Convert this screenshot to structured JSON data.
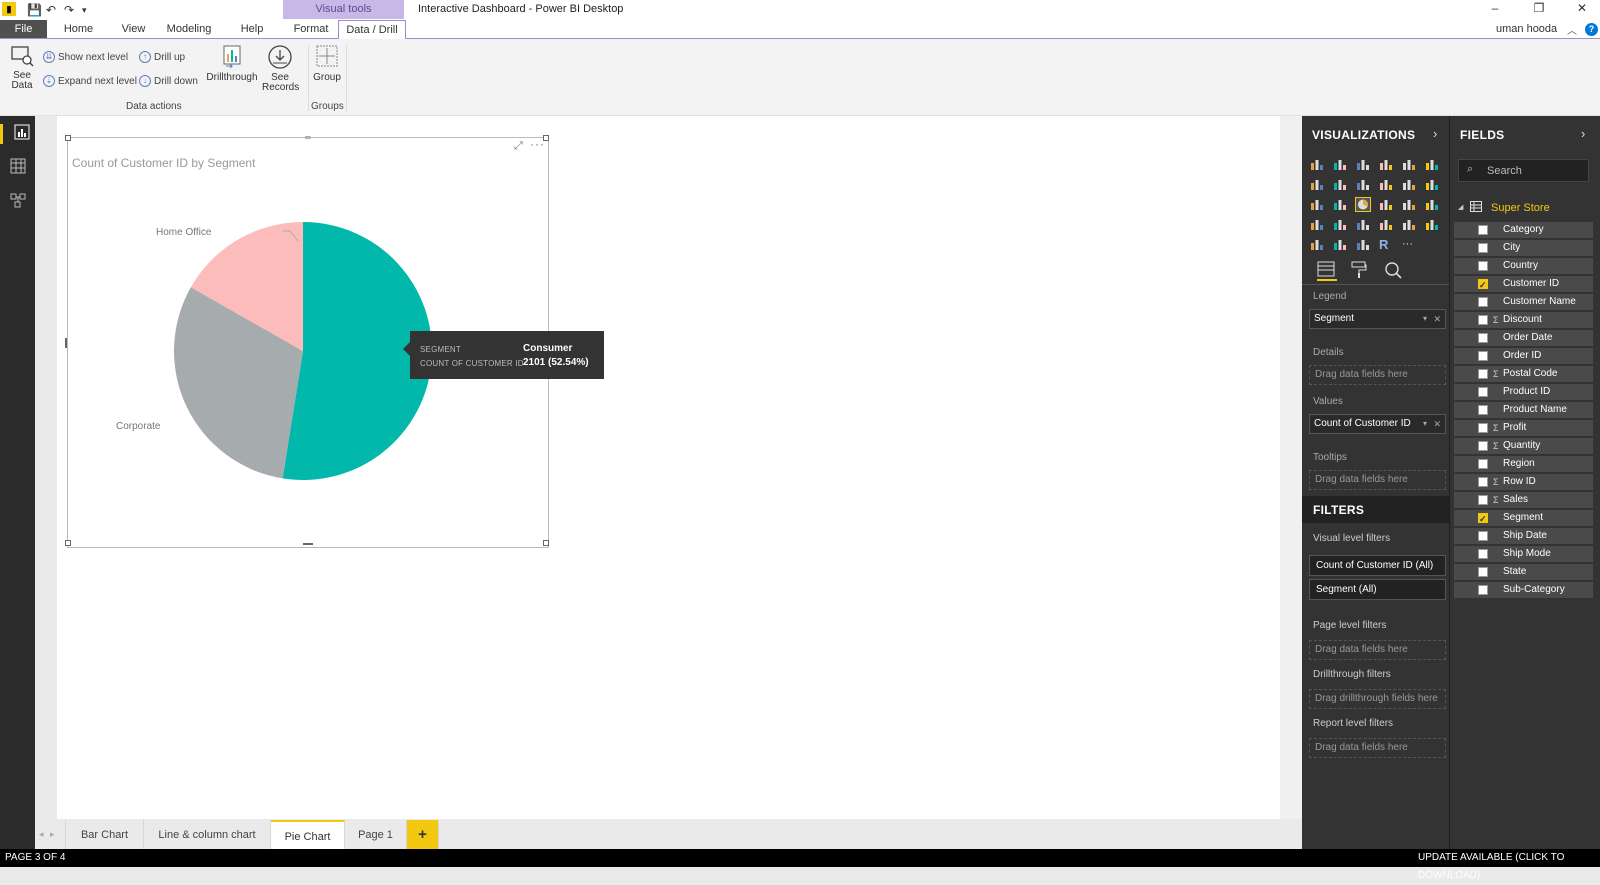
{
  "titlebar": {
    "context_tab": "Visual tools",
    "window_title": "Interactive Dashboard - Power BI Desktop",
    "minimize": "–",
    "restore": "❐",
    "close": "✕"
  },
  "menu": {
    "file": "File",
    "tabs": [
      "Home",
      "View",
      "Modeling",
      "Help",
      "Format",
      "Data / Drill"
    ],
    "user": "uman hooda",
    "help": "?"
  },
  "ribbon": {
    "see_data": "See\nData",
    "see_data_l1": "See",
    "see_data_l2": "Data",
    "show_next_level": "Show next level",
    "expand_next_level": "Expand next level",
    "drill_up": "Drill up",
    "drill_down": "Drill down",
    "drillthrough": "Drillthrough",
    "see_records_l1": "See",
    "see_records_l2": "Records",
    "group": "Group",
    "group_data_actions": "Data actions",
    "group_groups": "Groups"
  },
  "visual": {
    "title": "Count of Customer ID by Segment",
    "label_home_office": "Home Office",
    "label_corporate": "Corporate",
    "more": "···"
  },
  "chart_data": {
    "type": "pie",
    "title": "Count of Customer ID by Segment",
    "categories": [
      "Consumer",
      "Corporate",
      "Home Office"
    ],
    "values": [
      2101,
      1228,
      671
    ],
    "percent": [
      52.54,
      30.71,
      16.78
    ],
    "colors": [
      "#01b8aa",
      "#a6abae",
      "#fdbcbc"
    ]
  },
  "tooltip": {
    "key1": "SEGMENT",
    "val1": "Consumer",
    "key2": "COUNT OF CUSTOMER ID",
    "val2": "2101 (52.54%)"
  },
  "pages": {
    "tabs": [
      "Bar Chart",
      "Line & column chart",
      "Pie Chart",
      "Page 1"
    ],
    "add": "+",
    "nav_prev": "◂",
    "nav_next": "▸"
  },
  "status": {
    "page": "PAGE 3 OF 4",
    "update": "UPDATE AVAILABLE (CLICK TO DOWNLOAD)"
  },
  "viz_pane": {
    "header": "VISUALIZATIONS",
    "legend_label": "Legend",
    "legend_value": "Segment",
    "details_label": "Details",
    "drag_here": "Drag data fields here",
    "values_label": "Values",
    "values_value": "Count of Customer ID",
    "tooltips_label": "Tooltips",
    "filters_header": "FILTERS",
    "visual_filters": "Visual level filters",
    "filter1": "Count of Customer ID  (All)",
    "filter2": "Segment  (All)",
    "page_filters": "Page level filters",
    "drill_filters": "Drillthrough filters",
    "drill_drag": "Drag drillthrough fields here",
    "report_filters": "Report level filters"
  },
  "fields_pane": {
    "header": "FIELDS",
    "search_placeholder": "Search",
    "table": "Super Store",
    "fields": [
      {
        "name": "Category",
        "checked": false,
        "sigma": false
      },
      {
        "name": "City",
        "checked": false,
        "sigma": false
      },
      {
        "name": "Country",
        "checked": false,
        "sigma": false
      },
      {
        "name": "Customer ID",
        "checked": true,
        "sigma": false
      },
      {
        "name": "Customer Name",
        "checked": false,
        "sigma": false
      },
      {
        "name": "Discount",
        "checked": false,
        "sigma": true
      },
      {
        "name": "Order Date",
        "checked": false,
        "sigma": false
      },
      {
        "name": "Order ID",
        "checked": false,
        "sigma": false
      },
      {
        "name": "Postal Code",
        "checked": false,
        "sigma": true
      },
      {
        "name": "Product ID",
        "checked": false,
        "sigma": false
      },
      {
        "name": "Product Name",
        "checked": false,
        "sigma": false
      },
      {
        "name": "Profit",
        "checked": false,
        "sigma": true
      },
      {
        "name": "Quantity",
        "checked": false,
        "sigma": true
      },
      {
        "name": "Region",
        "checked": false,
        "sigma": false
      },
      {
        "name": "Row ID",
        "checked": false,
        "sigma": true
      },
      {
        "name": "Sales",
        "checked": false,
        "sigma": true
      },
      {
        "name": "Segment",
        "checked": true,
        "sigma": false
      },
      {
        "name": "Ship Date",
        "checked": false,
        "sigma": false
      },
      {
        "name": "Ship Mode",
        "checked": false,
        "sigma": false
      },
      {
        "name": "State",
        "checked": false,
        "sigma": false
      },
      {
        "name": "Sub-Category",
        "checked": false,
        "sigma": false
      }
    ]
  },
  "colors": {
    "accent": "#f2c811",
    "pane_bg": "#333333",
    "teal": "#01b8aa"
  }
}
